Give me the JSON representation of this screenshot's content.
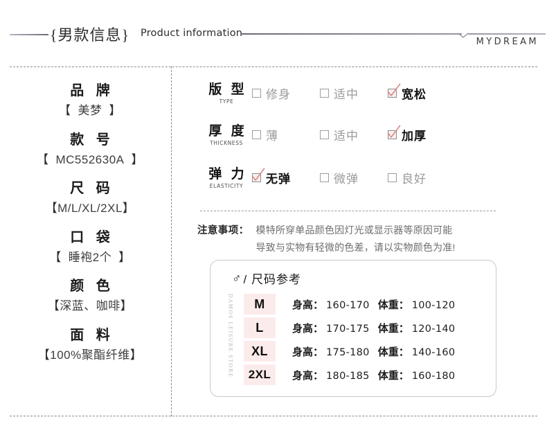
{
  "header": {
    "title_cn": "{男款信息}",
    "title_en": "Product information",
    "brand": "MYDREAM"
  },
  "left_specs": [
    {
      "title": "品 牌",
      "value_open": "【",
      "value": "美梦",
      "value_close": "】"
    },
    {
      "title": "款 号",
      "value_open": "【",
      "value": "MC552630A",
      "value_close": "】"
    },
    {
      "title": "尺 码",
      "value_open": "【",
      "value": "M/L/XL/2XL",
      "value_close": "】"
    },
    {
      "title": "口 袋",
      "value_open": "【",
      "value": "睡袍2个",
      "value_close": "】"
    },
    {
      "title": "颜 色",
      "value_open": "【",
      "value": "深蓝、咖啡",
      "value_close": "】"
    },
    {
      "title": "面 料",
      "value_open": "【",
      "value": "100%聚酯纤维",
      "value_close": "】"
    }
  ],
  "attributes": [
    {
      "label_cn": "版 型",
      "label_en": "TYPE",
      "options": [
        {
          "label": "修身",
          "checked": false
        },
        {
          "label": "适中",
          "checked": false
        },
        {
          "label": "宽松",
          "checked": true
        }
      ]
    },
    {
      "label_cn": "厚 度",
      "label_en": "THICKNESS",
      "options": [
        {
          "label": "薄",
          "checked": false
        },
        {
          "label": "适中",
          "checked": false
        },
        {
          "label": "加厚",
          "checked": true
        }
      ]
    },
    {
      "label_cn": "弹 力",
      "label_en": "ELASTICITY",
      "options": [
        {
          "label": "无弹",
          "checked": true
        },
        {
          "label": "微弹",
          "checked": false
        },
        {
          "label": "良好",
          "checked": false
        }
      ]
    }
  ],
  "note": {
    "label": "注意事项：",
    "line1": "模特所穿单品颜色因灯光或显示器等原因可能",
    "line2": "导致与实物有轻微的色差，请以实物颜色为准!"
  },
  "size_reference": {
    "male_symbol": "♂",
    "heading": "/ 尺码参考",
    "watermark": "DAMOS LEISURE STORE",
    "height_label": "身高：",
    "weight_label": "体重：",
    "rows": [
      {
        "size": "M",
        "height": "160-170",
        "weight": "100-120"
      },
      {
        "size": "L",
        "height": "170-175",
        "weight": "120-140"
      },
      {
        "size": "XL",
        "height": "175-180",
        "weight": "140-160"
      },
      {
        "size": "2XL",
        "height": "180-185",
        "weight": "160-180"
      }
    ]
  },
  "colors": {
    "accent_pink": "#fbeceb",
    "check_pink": "#e8a8a8",
    "line_purple": "#9b96a3",
    "muted_text": "#9a9a9a"
  }
}
